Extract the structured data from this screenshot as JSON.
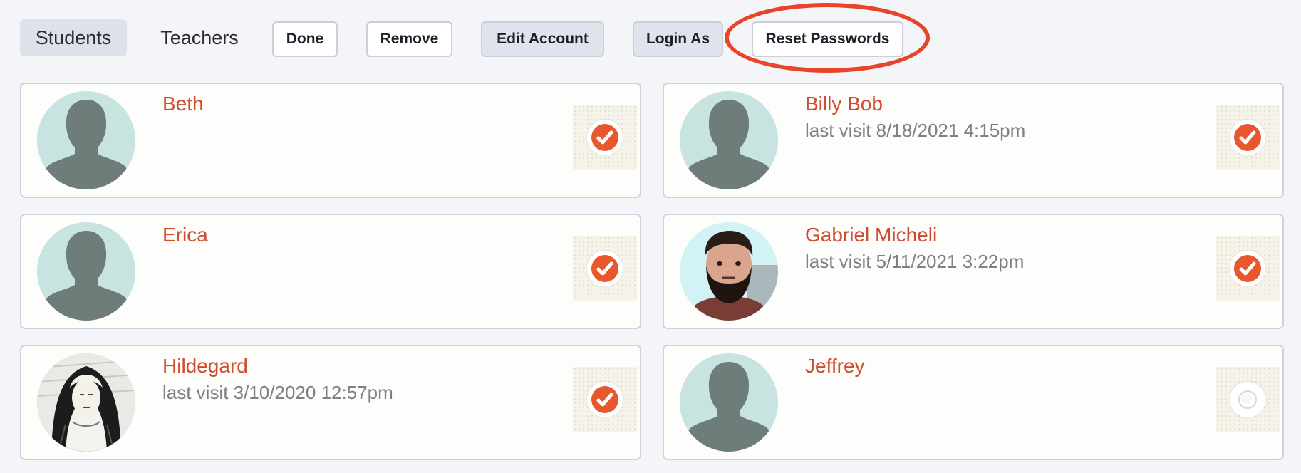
{
  "tabs": {
    "students": "Students",
    "teachers": "Teachers"
  },
  "toolbar": {
    "done": "Done",
    "remove": "Remove",
    "edit_account": "Edit Account",
    "login_as": "Login As",
    "reset_passwords": "Reset Passwords"
  },
  "colors": {
    "accent": "#cf4d2e",
    "check": "#e9572f",
    "highlight_ring": "#e8442c"
  },
  "students": [
    {
      "name": "Beth",
      "last_visit": "",
      "avatar": "default-silhouette",
      "selected": true
    },
    {
      "name": "Billy Bob",
      "last_visit": "last visit 8/18/2021 4:15pm",
      "avatar": "default-silhouette",
      "selected": true
    },
    {
      "name": "Erica",
      "last_visit": "",
      "avatar": "default-silhouette",
      "selected": true
    },
    {
      "name": "Gabriel Micheli",
      "last_visit": "last visit 5/11/2021 3:22pm",
      "avatar": "photo",
      "selected": true
    },
    {
      "name": "Hildegard",
      "last_visit": "last visit 3/10/2020 12:57pm",
      "avatar": "engraving",
      "selected": true
    },
    {
      "name": "Jeffrey",
      "last_visit": "",
      "avatar": "default-silhouette",
      "selected": false
    }
  ]
}
